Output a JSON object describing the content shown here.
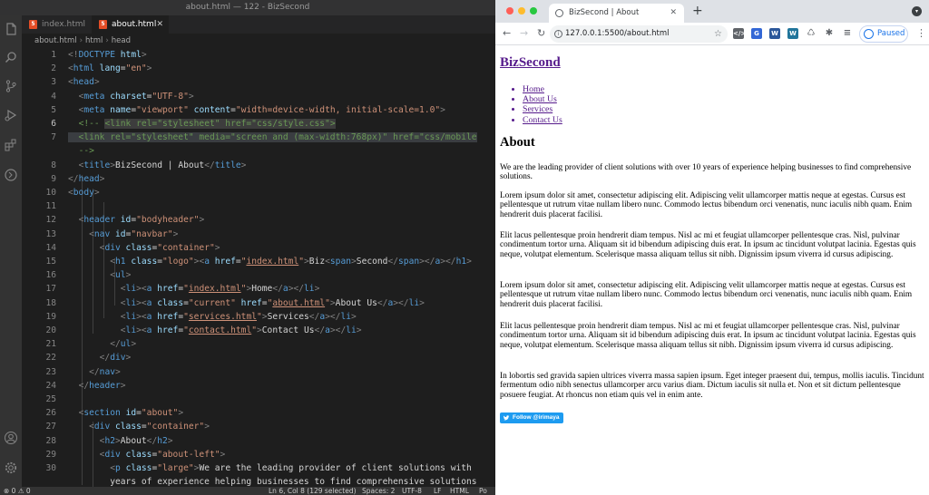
{
  "vscode": {
    "window_title": "about.html — 122 - BizSecond",
    "tabs": [
      {
        "label": "index.html",
        "badge": "5",
        "active": false
      },
      {
        "label": "about.html",
        "badge": "5",
        "active": true
      }
    ],
    "breadcrumb": [
      "about.html",
      "html",
      "head"
    ],
    "code_lines": [
      {
        "n": "1",
        "html": "<span class='t-br'>&lt;!</span><span class='t-doc'>DOCTYPE</span> <span class='t-at'>html</span><span class='t-br'>&gt;</span>"
      },
      {
        "n": "2",
        "html": "<span class='t-br'>&lt;</span><span class='t-tag'>html</span> <span class='t-at'>lang</span><span class='t-tx'>=</span><span class='t-str'>\"en\"</span><span class='t-br'>&gt;</span>"
      },
      {
        "n": "3",
        "html": "<span class='t-br'>&lt;</span><span class='t-tag'>head</span><span class='t-br'>&gt;</span>"
      },
      {
        "n": "4",
        "html": "  <span class='t-br'>&lt;</span><span class='t-tag'>meta</span> <span class='t-at'>charset</span><span class='t-tx'>=</span><span class='t-str'>\"UTF-8\"</span><span class='t-br'>&gt;</span>"
      },
      {
        "n": "5",
        "html": "  <span class='t-br'>&lt;</span><span class='t-tag'>meta</span> <span class='t-at'>name</span><span class='t-tx'>=</span><span class='t-str'>\"viewport\"</span> <span class='t-at'>content</span><span class='t-tx'>=</span><span class='t-str'>\"width=device-width, initial-scale=1.0\"</span><span class='t-br'>&gt;</span>"
      },
      {
        "n": "6",
        "html": "  <span class='t-cm'>&lt;!-- </span><span class='t-cm lightsel'>&lt;link rel=\"stylesheet\" href=\"css/style.css\"&gt;</span>"
      },
      {
        "n": "7",
        "html": "<span class='t-cm sel'>  &lt;link rel=\"stylesheet\" media=\"screen and (max-width:768px)\" href=\"css/mobile</span>"
      },
      {
        "n": "",
        "html": "  <span class='t-cm'>--&gt;</span>"
      },
      {
        "n": "8",
        "html": "  <span class='t-br'>&lt;</span><span class='t-tag'>title</span><span class='t-br'>&gt;</span><span class='t-tx'>BizSecond | About</span><span class='t-br'>&lt;/</span><span class='t-tag'>title</span><span class='t-br'>&gt;</span>"
      },
      {
        "n": "9",
        "html": "<span class='t-br'>&lt;/</span><span class='t-tag'>head</span><span class='t-br'>&gt;</span>"
      },
      {
        "n": "10",
        "html": "<span class='t-br'>&lt;</span><span class='t-tag'>body</span><span class='t-br'>&gt;</span>"
      },
      {
        "n": "11",
        "html": ""
      },
      {
        "n": "12",
        "html": "  <span class='t-br'>&lt;</span><span class='t-tag'>header</span> <span class='t-at'>id</span><span class='t-tx'>=</span><span class='t-str'>\"bodyheader\"</span><span class='t-br'>&gt;</span>"
      },
      {
        "n": "13",
        "html": "    <span class='t-br'>&lt;</span><span class='t-tag'>nav</span> <span class='t-at'>id</span><span class='t-tx'>=</span><span class='t-str'>\"navbar\"</span><span class='t-br'>&gt;</span>"
      },
      {
        "n": "14",
        "html": "      <span class='t-br'>&lt;</span><span class='t-tag'>div</span> <span class='t-at'>class</span><span class='t-tx'>=</span><span class='t-str'>\"container\"</span><span class='t-br'>&gt;</span>"
      },
      {
        "n": "15",
        "html": "        <span class='t-br'>&lt;</span><span class='t-tag'>h1</span> <span class='t-at'>class</span><span class='t-tx'>=</span><span class='t-str'>\"logo\"</span><span class='t-br'>&gt;&lt;</span><span class='t-tag'>a</span> <span class='t-at'>href</span><span class='t-tx'>=</span><span class='t-str'>\"<span class='t-u'>index.html</span>\"</span><span class='t-br'>&gt;</span><span class='t-tx'>Biz</span><span class='t-br'>&lt;</span><span class='t-tag'>span</span><span class='t-br'>&gt;</span><span class='t-tx'>Second</span><span class='t-br'>&lt;/</span><span class='t-tag'>span</span><span class='t-br'>&gt;&lt;/</span><span class='t-tag'>a</span><span class='t-br'>&gt;&lt;/</span><span class='t-tag'>h1</span><span class='t-br'>&gt;</span>"
      },
      {
        "n": "16",
        "html": "        <span class='t-br'>&lt;</span><span class='t-tag'>ul</span><span class='t-br'>&gt;</span>"
      },
      {
        "n": "17",
        "html": "          <span class='t-br'>&lt;</span><span class='t-tag'>li</span><span class='t-br'>&gt;&lt;</span><span class='t-tag'>a</span> <span class='t-at'>href</span><span class='t-tx'>=</span><span class='t-str'>\"<span class='t-u'>index.html</span>\"</span><span class='t-br'>&gt;</span><span class='t-tx'>Home</span><span class='t-br'>&lt;/</span><span class='t-tag'>a</span><span class='t-br'>&gt;&lt;/</span><span class='t-tag'>li</span><span class='t-br'>&gt;</span>"
      },
      {
        "n": "18",
        "html": "          <span class='t-br'>&lt;</span><span class='t-tag'>li</span><span class='t-br'>&gt;&lt;</span><span class='t-tag'>a</span> <span class='t-at'>class</span><span class='t-tx'>=</span><span class='t-str'>\"current\"</span> <span class='t-at'>href</span><span class='t-tx'>=</span><span class='t-str'>\"<span class='t-u'>about.html</span>\"</span><span class='t-br'>&gt;</span><span class='t-tx'>About Us</span><span class='t-br'>&lt;/</span><span class='t-tag'>a</span><span class='t-br'>&gt;&lt;/</span><span class='t-tag'>li</span><span class='t-br'>&gt;</span>"
      },
      {
        "n": "19",
        "html": "          <span class='t-br'>&lt;</span><span class='t-tag'>li</span><span class='t-br'>&gt;&lt;</span><span class='t-tag'>a</span> <span class='t-at'>href</span><span class='t-tx'>=</span><span class='t-str'>\"<span class='t-u'>services.html</span>\"</span><span class='t-br'>&gt;</span><span class='t-tx'>Services</span><span class='t-br'>&lt;/</span><span class='t-tag'>a</span><span class='t-br'>&gt;&lt;/</span><span class='t-tag'>li</span><span class='t-br'>&gt;</span>"
      },
      {
        "n": "20",
        "html": "          <span class='t-br'>&lt;</span><span class='t-tag'>li</span><span class='t-br'>&gt;&lt;</span><span class='t-tag'>a</span> <span class='t-at'>href</span><span class='t-tx'>=</span><span class='t-str'>\"<span class='t-u'>contact.html</span>\"</span><span class='t-br'>&gt;</span><span class='t-tx'>Contact Us</span><span class='t-br'>&lt;/</span><span class='t-tag'>a</span><span class='t-br'>&gt;&lt;/</span><span class='t-tag'>li</span><span class='t-br'>&gt;</span>"
      },
      {
        "n": "21",
        "html": "        <span class='t-br'>&lt;/</span><span class='t-tag'>ul</span><span class='t-br'>&gt;</span>"
      },
      {
        "n": "22",
        "html": "      <span class='t-br'>&lt;/</span><span class='t-tag'>div</span><span class='t-br'>&gt;</span>"
      },
      {
        "n": "23",
        "html": "    <span class='t-br'>&lt;/</span><span class='t-tag'>nav</span><span class='t-br'>&gt;</span>"
      },
      {
        "n": "24",
        "html": "  <span class='t-br'>&lt;/</span><span class='t-tag'>header</span><span class='t-br'>&gt;</span>"
      },
      {
        "n": "25",
        "html": ""
      },
      {
        "n": "26",
        "html": "  <span class='t-br'>&lt;</span><span class='t-tag'>section</span> <span class='t-at'>id</span><span class='t-tx'>=</span><span class='t-str'>\"about\"</span><span class='t-br'>&gt;</span>"
      },
      {
        "n": "27",
        "html": "    <span class='t-br'>&lt;</span><span class='t-tag'>div</span> <span class='t-at'>class</span><span class='t-tx'>=</span><span class='t-str'>\"container\"</span><span class='t-br'>&gt;</span>"
      },
      {
        "n": "28",
        "html": "      <span class='t-br'>&lt;</span><span class='t-tag'>h2</span><span class='t-br'>&gt;</span><span class='t-tx'>About</span><span class='t-br'>&lt;/</span><span class='t-tag'>h2</span><span class='t-br'>&gt;</span>"
      },
      {
        "n": "29",
        "html": "      <span class='t-br'>&lt;</span><span class='t-tag'>div</span> <span class='t-at'>class</span><span class='t-tx'>=</span><span class='t-str'>\"about-left\"</span><span class='t-br'>&gt;</span>"
      },
      {
        "n": "30",
        "html": "        <span class='t-br'>&lt;</span><span class='t-tag'>p</span> <span class='t-at'>class</span><span class='t-tx'>=</span><span class='t-str'>\"large\"</span><span class='t-br'>&gt;</span><span class='t-tx'>We are the leading provider of client solutions with</span>"
      },
      {
        "n": "",
        "html": "        <span class='t-tx'>years of experience helping businesses to find comprehensive solutions</span>"
      }
    ],
    "status": {
      "problems": "⊗ 0 ⚠ 0",
      "position": "Ln 6, Col 8 (129 selected)",
      "spaces": "Spaces: 2",
      "encoding": "UTF-8",
      "eol": "LF",
      "language": "HTML",
      "port": "Po"
    }
  },
  "chrome": {
    "tab_title": "BizSecond | About",
    "url": "127.0.0.1:5500/about.html",
    "profile_label": "Paused",
    "extensions": [
      {
        "label": "</>",
        "color": "#5f6368"
      },
      {
        "label": "G",
        "color": "#3367d6"
      },
      {
        "label": "W",
        "color": "#2b579a"
      },
      {
        "label": "W",
        "color": "#21759b"
      },
      {
        "label": "♺",
        "color": "#5f6368"
      },
      {
        "label": "✱",
        "color": "#5f6368"
      }
    ]
  },
  "page": {
    "logo": "BizSecond",
    "nav": [
      "Home",
      "About Us",
      "Services",
      "Contact Us"
    ],
    "heading": "About",
    "paragraphs": [
      "We are the leading provider of client solutions with over 10 years of experience helping businesses to find comprehensive solutions.",
      "Lorem ipsum dolor sit amet, consectetur adipiscing elit. Adipiscing velit ullamcorper mattis neque at egestas. Cursus est pellentesque ut rutrum vitae nullam libero nunc. Commodo lectus bibendum orci venenatis, nunc iaculis nibh quam. Enim hendrerit duis placerat facilisi.",
      "Elit lacus pellentesque proin hendrerit diam tempus. Nisl ac mi et feugiat ullamcorper pellentesque cras. Nisl, pulvinar condimentum tortor urna. Aliquam sit id bibendum adipiscing duis erat. In ipsum ac tincidunt volutpat lacinia. Egestas quis neque, volutpat elementum. Scelerisque massa aliquam tellus sit nibh. Dignissim ipsum viverra id cursus adipiscing.",
      "Lorem ipsum dolor sit amet, consectetur adipiscing elit. Adipiscing velit ullamcorper mattis neque at egestas. Cursus est pellentesque ut rutrum vitae nullam libero nunc. Commodo lectus bibendum orci venenatis, nunc iaculis nibh quam. Enim hendrerit duis placerat facilisi.",
      "Elit lacus pellentesque proin hendrerit diam tempus. Nisl ac mi et feugiat ullamcorper pellentesque cras. Nisl, pulvinar condimentum tortor urna. Aliquam sit id bibendum adipiscing duis erat. In ipsum ac tincidunt volutpat lacinia. Egestas quis neque, volutpat elementum. Scelerisque massa aliquam tellus sit nibh. Dignissim ipsum viverra id cursus adipiscing.",
      "In lobortis sed gravida sapien ultrices viverra massa sapien ipsum. Eget integer praesent dui, tempus, mollis iaculis. Tincidunt fermentum odio nibh senectus ullamcorper arcu varius diam. Dictum iaculis sit nulla et. Non et sit dictum pellentesque posuere feugiat. At rhoncus non etiam quis vel in enim ante."
    ],
    "twitter_button": "Follow @irimaya"
  }
}
